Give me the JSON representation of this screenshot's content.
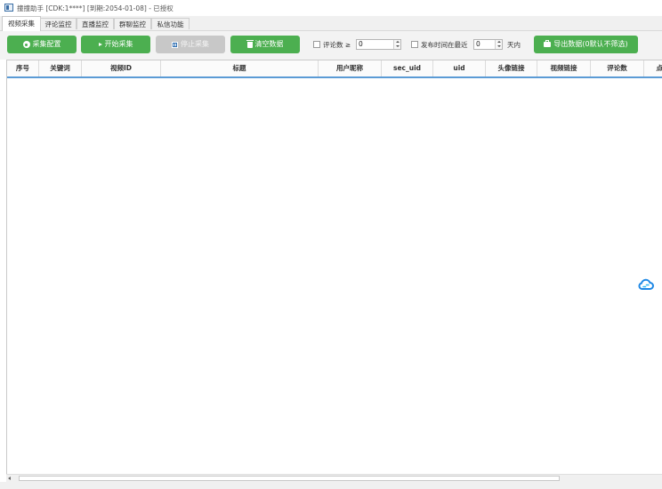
{
  "window": {
    "title": "撞撞助手 [CDK:1****] [到期:2054-01-08] - 已授权"
  },
  "tabs": [
    {
      "label": "视频采集",
      "active": true
    },
    {
      "label": "评论监控",
      "active": false
    },
    {
      "label": "直播监控",
      "active": false
    },
    {
      "label": "群聊监控",
      "active": false
    },
    {
      "label": "私信功能",
      "active": false
    }
  ],
  "toolbar": {
    "config_label": "采集配置",
    "start_label": "开始采集",
    "stop_label": "停止采集",
    "clear_label": "清空数据",
    "comment_filter_label": "评论数 ≥",
    "comment_filter_value": "0",
    "recent_filter_label": "发布时间在最近",
    "recent_filter_value": "0",
    "days_label": "天内",
    "export_label": "导出数据(0默认不筛选)"
  },
  "table": {
    "columns": [
      "序号",
      "关键词",
      "视频ID",
      "标题",
      "用户昵称",
      "sec_uid",
      "uid",
      "头像链接",
      "视频链接",
      "评论数",
      "点"
    ],
    "rows": []
  },
  "colors": {
    "accent_green": "#4caf50",
    "header_line": "#5b9bd5",
    "cloud_blue": "#1e88e5"
  },
  "icons": [
    "app-icon",
    "gear-icon",
    "play-icon",
    "pause-icon",
    "trash-icon",
    "export-icon",
    "cloud-icon"
  ]
}
